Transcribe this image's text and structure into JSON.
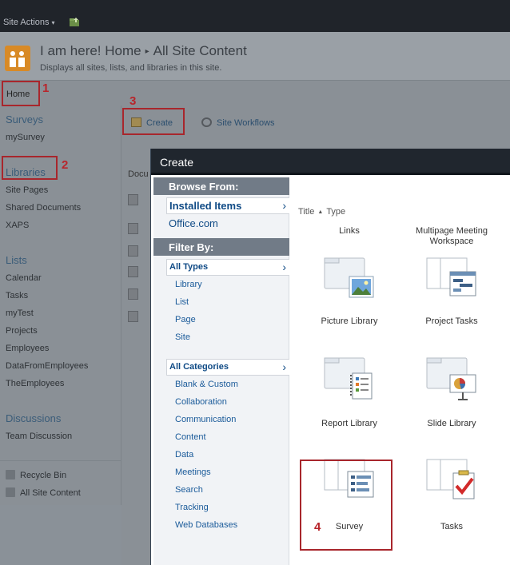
{
  "topbar": {
    "site_actions": "Site Actions",
    "caret": "▾"
  },
  "header": {
    "site_name": "I am here! Home",
    "separator": "▸",
    "page_name": "All Site Content",
    "description": "Displays all sites, lists, and libraries in this site."
  },
  "linkbar": {
    "home": "Home"
  },
  "annotations": {
    "n1": "1",
    "n2": "2",
    "n3": "3",
    "n4": "4"
  },
  "quicklaunch": {
    "surveys_heading": "Surveys",
    "surveys_items": [
      "mySurvey"
    ],
    "libraries_heading": "Libraries",
    "libraries_items": [
      "Site Pages",
      "Shared Documents",
      "XAPS"
    ],
    "lists_heading": "Lists",
    "lists_items": [
      "Calendar",
      "Tasks",
      "myTest",
      "Projects",
      "Employees",
      "DataFromEmployees",
      "TheEmployees"
    ],
    "discussions_heading": "Discussions",
    "discussions_items": [
      "Team Discussion"
    ],
    "recycle_bin": "Recycle Bin",
    "all_site_content": "All Site Content"
  },
  "toolbar": {
    "create": "Create",
    "site_workflows": "Site Workflows"
  },
  "main": {
    "doc_header": "Docu"
  },
  "dialog": {
    "title": "Create",
    "browse_from": "Browse From:",
    "installed_items": "Installed Items",
    "office_com": "Office.com",
    "filter_by": "Filter By:",
    "all_types": "All Types",
    "types": [
      "Library",
      "List",
      "Page",
      "Site"
    ],
    "all_categories": "All Categories",
    "categories": [
      "Blank & Custom",
      "Collaboration",
      "Communication",
      "Content",
      "Data",
      "Meetings",
      "Search",
      "Tracking",
      "Web Databases"
    ],
    "arrow": "›",
    "sort_title": "Title",
    "sort_arrow": "▲",
    "sort_type": "Type",
    "tiles": {
      "links": "Links",
      "multipage": "Multipage Meeting Workspace",
      "picture_library": "Picture Library",
      "project_tasks": "Project Tasks",
      "report_library": "Report Library",
      "slide_library": "Slide Library",
      "survey": "Survey",
      "tasks": "Tasks"
    }
  },
  "colors": {
    "annotation": "#a8262c",
    "link": "#0f4a85",
    "dialog_header": "#20262e"
  }
}
